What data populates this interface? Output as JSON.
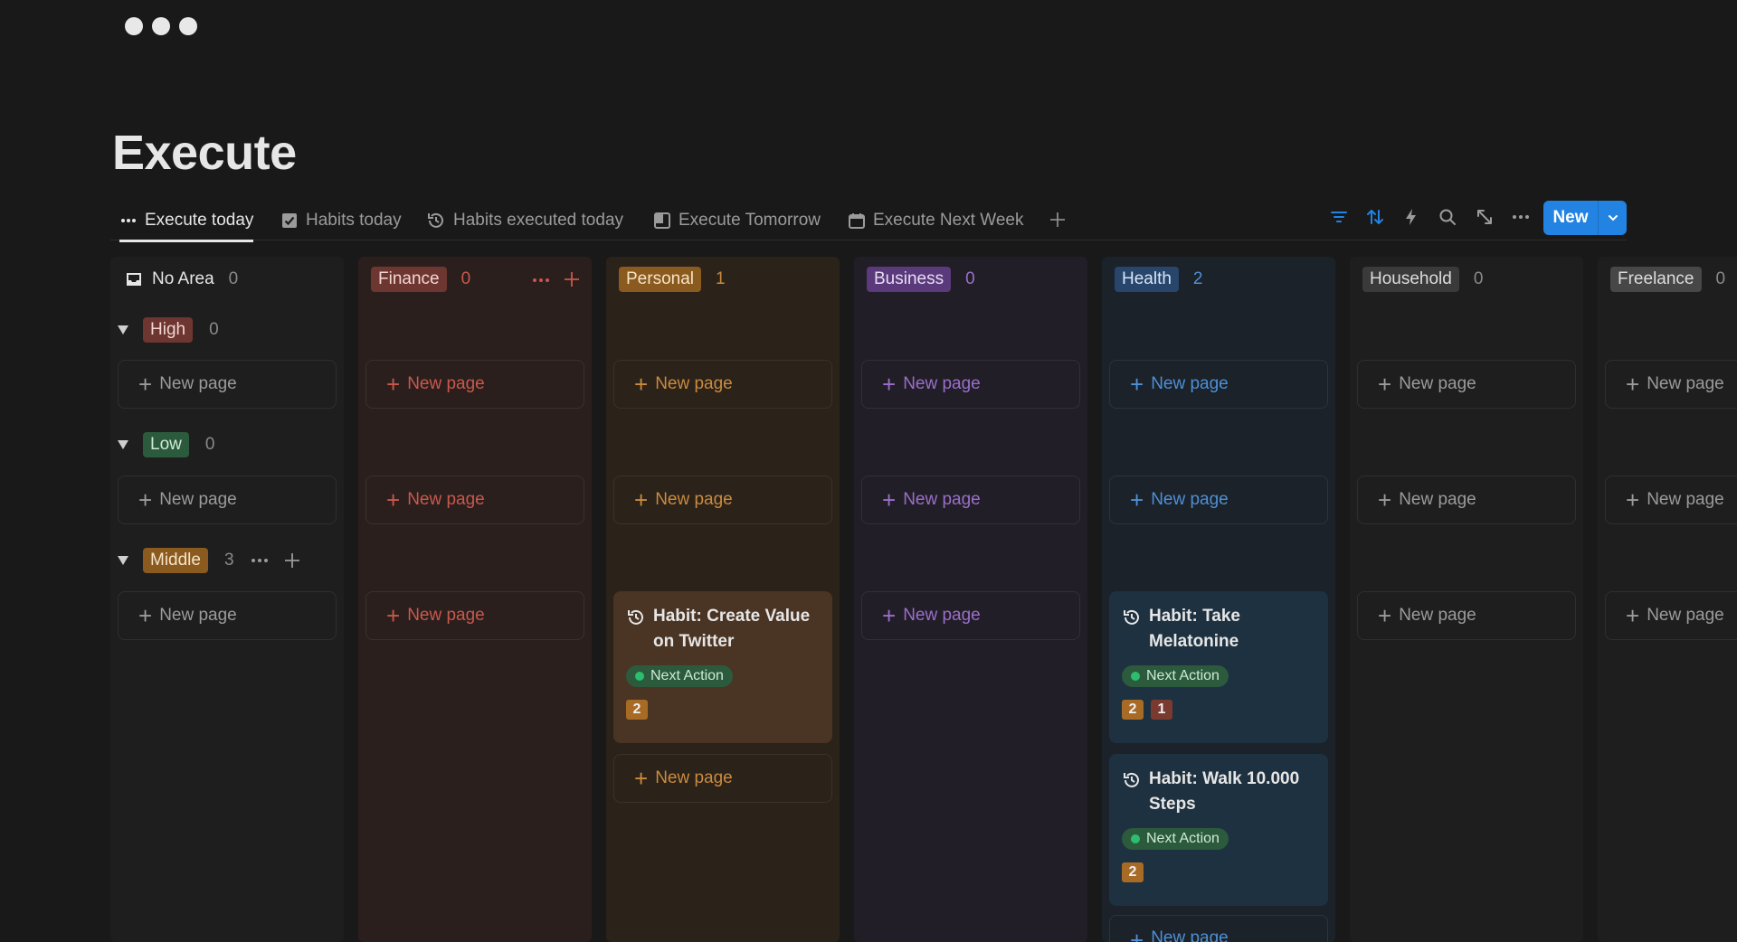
{
  "page": {
    "title": "Execute"
  },
  "tabs": [
    {
      "label": "Execute today",
      "icon": "more-dots-icon",
      "active": true
    },
    {
      "label": "Habits today",
      "icon": "checkbox-icon"
    },
    {
      "label": "Habits executed today",
      "icon": "history-icon"
    },
    {
      "label": "Execute Tomorrow",
      "icon": "board-icon"
    },
    {
      "label": "Execute Next Week",
      "icon": "calendar-icon"
    }
  ],
  "toolbar": {
    "icons": [
      "filter-icon",
      "sort-icon",
      "lightning-icon",
      "search-icon",
      "expand-icon",
      "more-icon"
    ],
    "new_label": "New",
    "accent": "#2383e2"
  },
  "columns": [
    {
      "name": "No Area",
      "count": "0",
      "icon": "inbox-icon"
    },
    {
      "name": "Finance",
      "count": "0"
    },
    {
      "name": "Personal",
      "count": "1"
    },
    {
      "name": "Business",
      "count": "0"
    },
    {
      "name": "Health",
      "count": "2"
    },
    {
      "name": "Household",
      "count": "0"
    },
    {
      "name": "Freelance",
      "count": "0"
    }
  ],
  "groups": [
    {
      "name": "High",
      "count": "0"
    },
    {
      "name": "Low",
      "count": "0"
    },
    {
      "name": "Middle",
      "count": "3"
    }
  ],
  "new_page_label": "New page",
  "cards": {
    "personal_1": {
      "title": "Habit: Create Value on Twitter",
      "status": "Next Action",
      "nums": [
        "2"
      ]
    },
    "health_1": {
      "title": "Habit: Take Melatonine",
      "status": "Next Action",
      "nums": [
        "2",
        "1"
      ]
    },
    "health_2": {
      "title": "Habit: Walk 10.000 Steps",
      "status": "Next Action",
      "nums": [
        "2"
      ]
    }
  }
}
